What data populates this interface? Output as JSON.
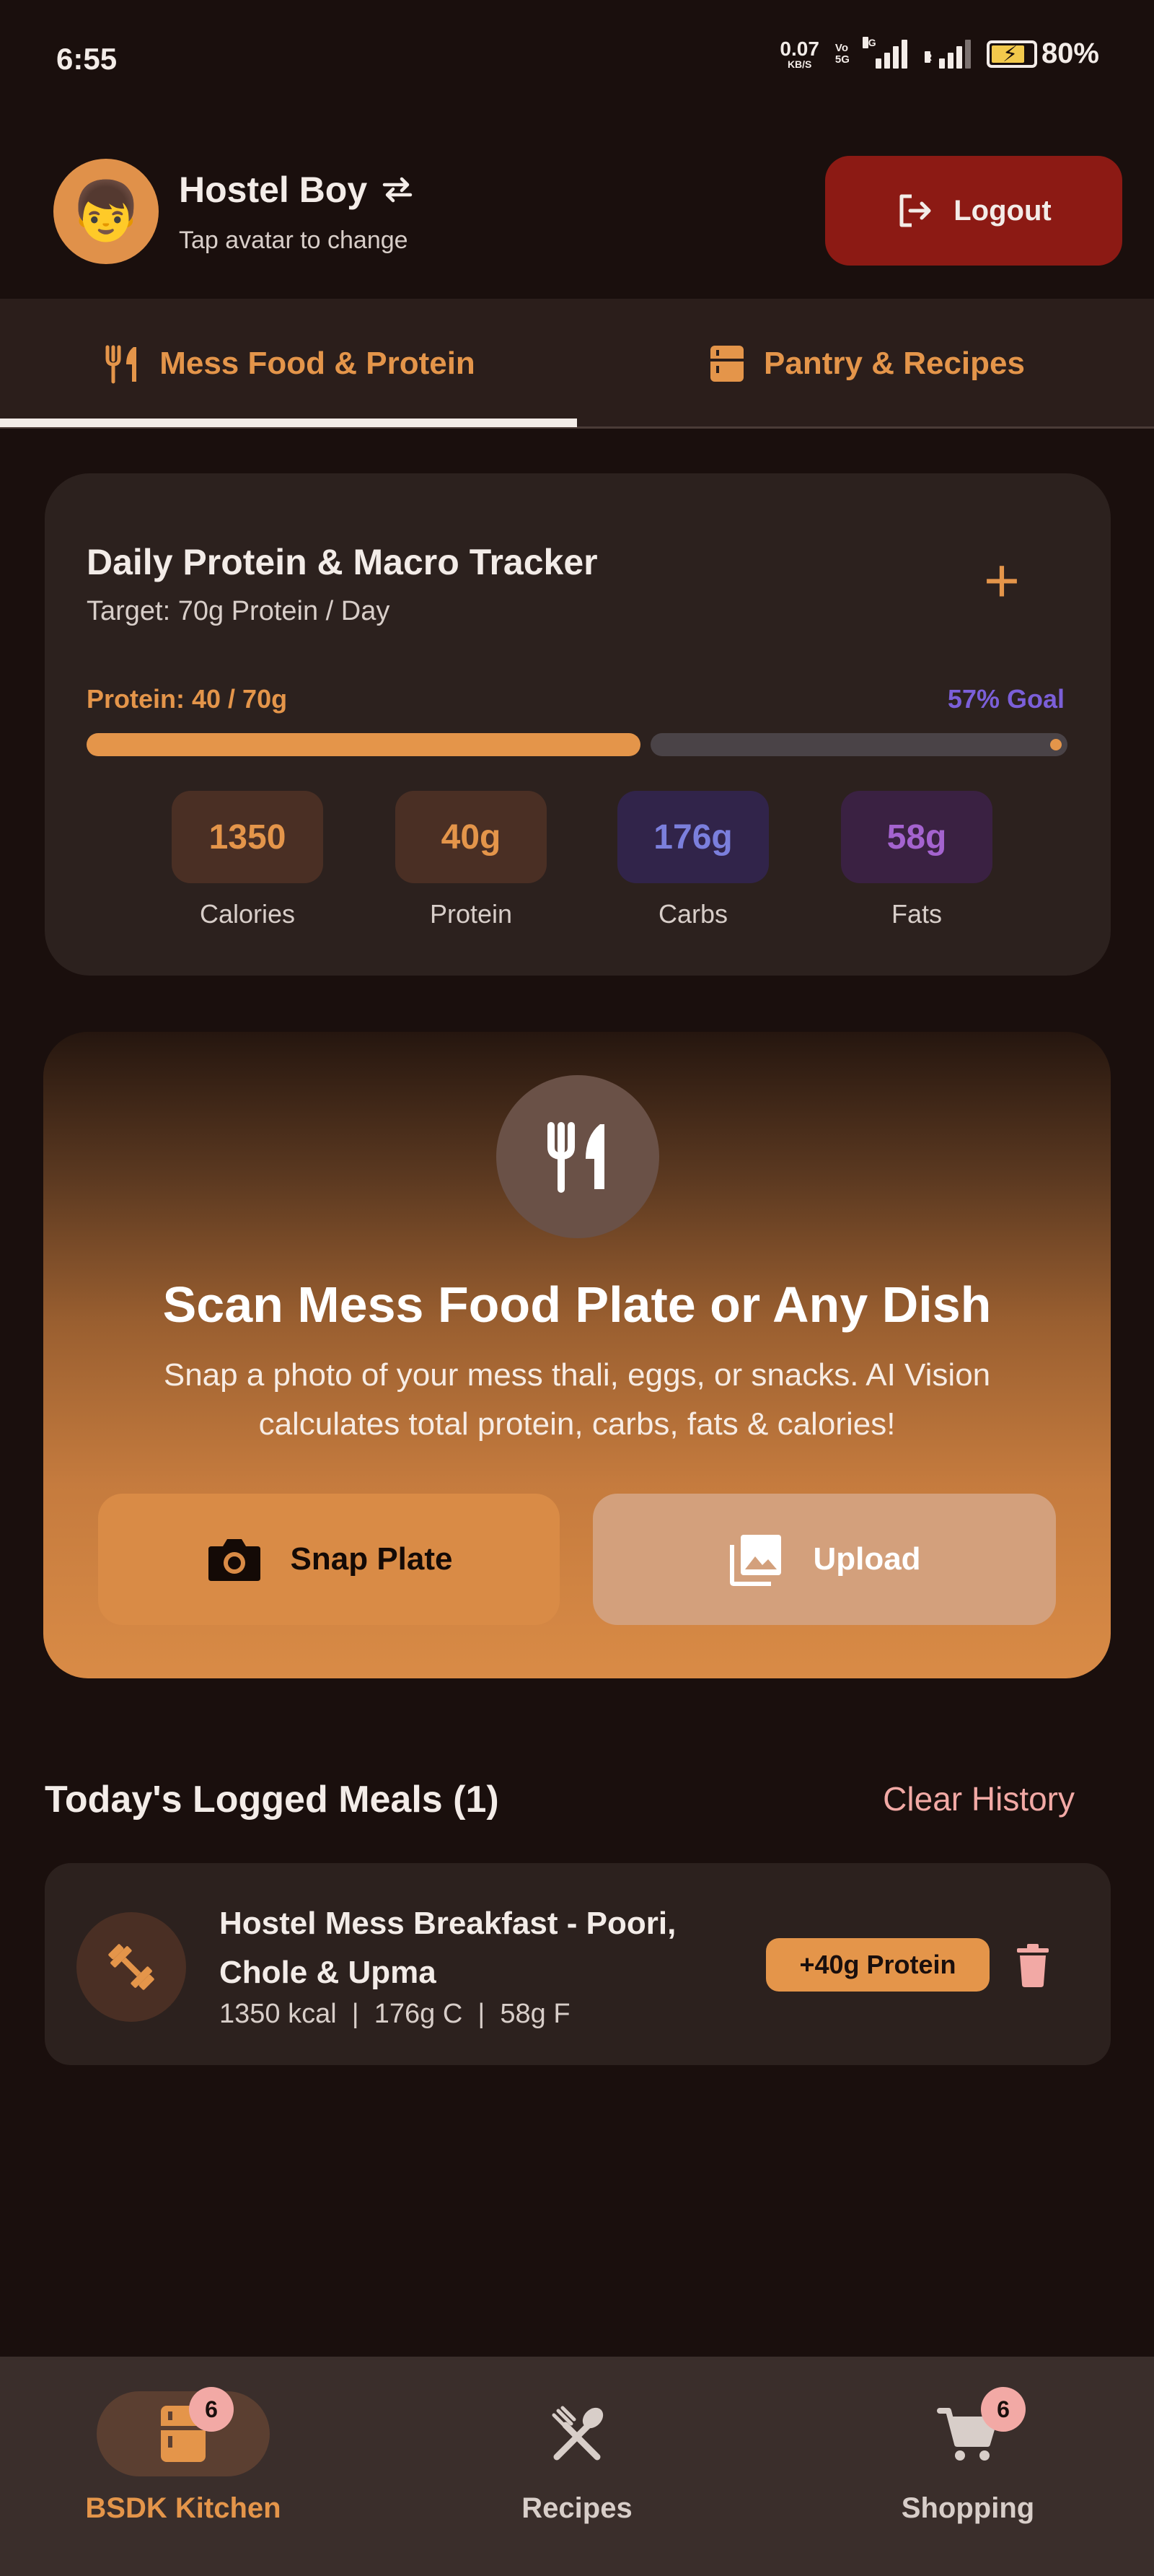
{
  "status_bar": {
    "time": "6:55",
    "net_speed": "0.07",
    "net_unit": "KB/S",
    "volte_top": "Vo",
    "volte_bottom": "5G",
    "signal1_tag": "5G",
    "signal2_tag": "R",
    "battery": "80%"
  },
  "header": {
    "user_name": "Hostel Boy",
    "hint": "Tap avatar to change",
    "avatar_emoji": "👦",
    "logout_label": "Logout"
  },
  "tabs": [
    {
      "label": "Mess Food & Protein",
      "icon": "fork-knife-icon",
      "active": true
    },
    {
      "label": "Pantry & Recipes",
      "icon": "fridge-icon",
      "active": false
    }
  ],
  "tracker": {
    "title": "Daily Protein & Macro Tracker",
    "target": "Target: 70g Protein / Day",
    "add_symbol": "+",
    "protein_label": "Protein: 40 / 70g",
    "goal_label": "57% Goal",
    "progress_fraction": 0.57,
    "macros": [
      {
        "value": "1350",
        "label": "Calories"
      },
      {
        "value": "40g",
        "label": "Protein"
      },
      {
        "value": "176g",
        "label": "Carbs"
      },
      {
        "value": "58g",
        "label": "Fats"
      }
    ]
  },
  "scan": {
    "title": "Scan Mess Food Plate or Any Dish",
    "description": "Snap a photo of your mess thali, eggs, or snacks. AI Vision calculates total protein, carbs, fats & calories!",
    "snap_label": "Snap Plate",
    "upload_label": "Upload"
  },
  "meals": {
    "title": "Today's Logged Meals (1)",
    "clear_label": "Clear History",
    "items": [
      {
        "name": "Hostel Mess Breakfast - Poori, Chole & Upma",
        "stats": "1350 kcal  |  176g C  |  58g F",
        "badge": "+40g Protein",
        "icon": "dumbbell-icon"
      }
    ]
  },
  "bottom_nav": [
    {
      "label": "BSDK Kitchen",
      "icon": "fridge-icon",
      "badge": "6",
      "active": true
    },
    {
      "label": "Recipes",
      "icon": "utensils-cross-icon",
      "badge": "",
      "active": false
    },
    {
      "label": "Shopping",
      "icon": "cart-icon",
      "badge": "6",
      "active": false
    }
  ],
  "colors": {
    "background": "#1a0f0d",
    "accent": "#e4954a",
    "logout": "#8c1a14",
    "purple": "#7b5fd8",
    "pink": "#f2a9a5"
  }
}
